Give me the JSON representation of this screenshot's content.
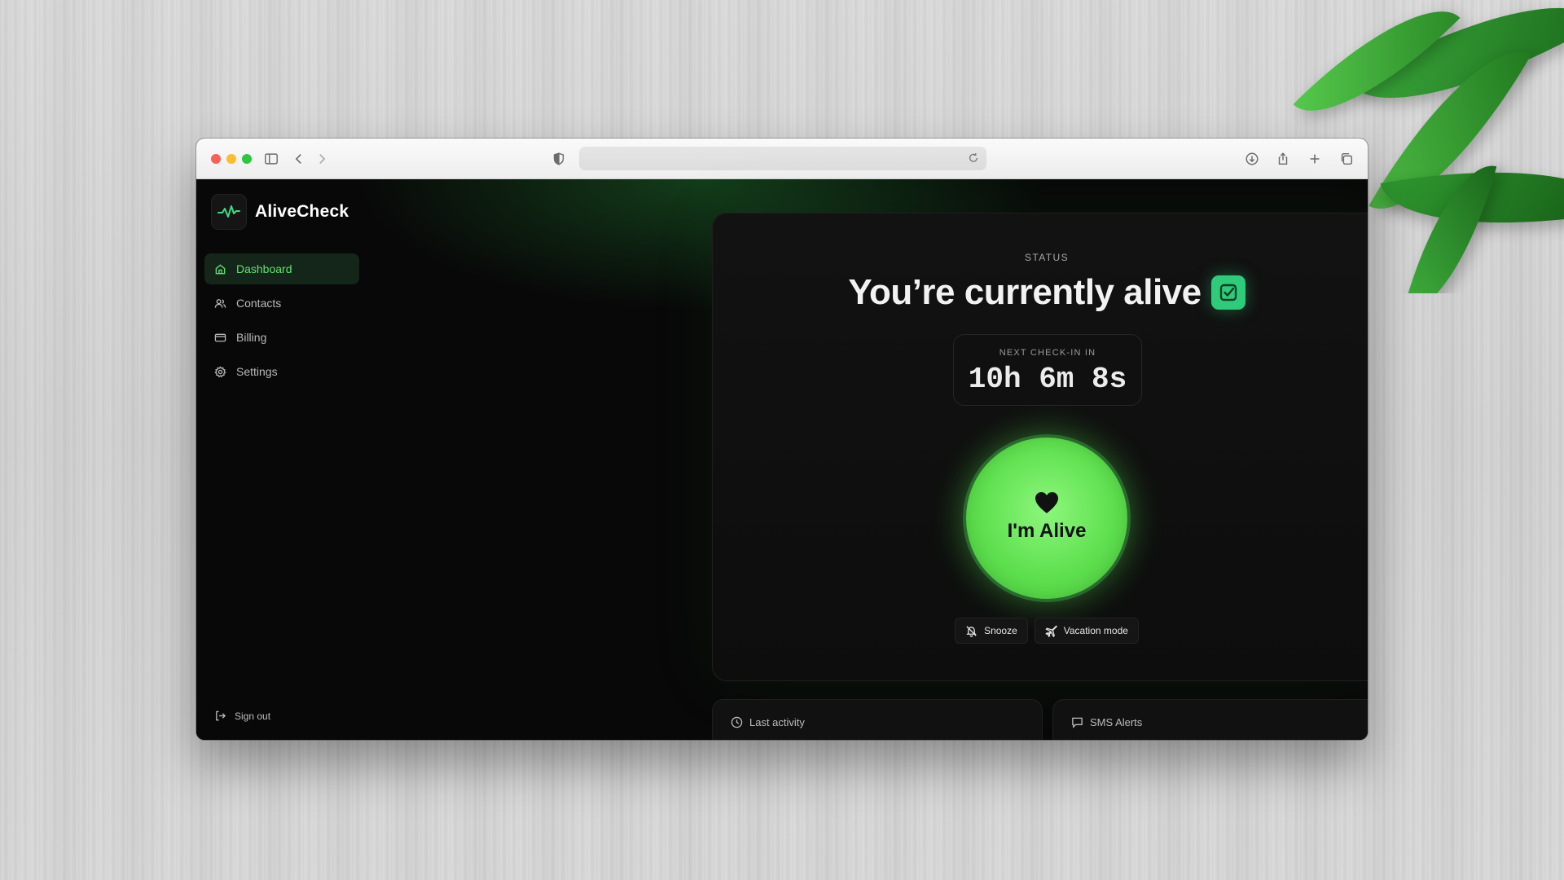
{
  "browser": {
    "url": ""
  },
  "app": {
    "brand_name": "AliveCheck",
    "accent_color": "#5fe36f",
    "check_color": "#2ecc7a"
  },
  "sidebar": {
    "items": [
      {
        "label": "Dashboard",
        "icon": "home-icon",
        "active": true
      },
      {
        "label": "Contacts",
        "icon": "users-icon",
        "active": false
      },
      {
        "label": "Billing",
        "icon": "credit-card-icon",
        "active": false
      },
      {
        "label": "Settings",
        "icon": "gear-icon",
        "active": false
      }
    ],
    "sign_out": "Sign out"
  },
  "status": {
    "label": "STATUS",
    "headline": "You’re currently alive",
    "next_checkin_label": "NEXT CHECK-IN IN",
    "countdown": "10h 6m 8s",
    "alive_button": "I'm Alive",
    "snooze": "Snooze",
    "vacation": "Vacation mode"
  },
  "cards": {
    "last_activity": "Last activity",
    "sms_alerts": "SMS Alerts"
  }
}
